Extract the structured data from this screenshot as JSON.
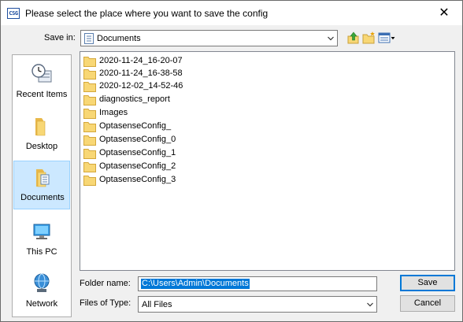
{
  "window": {
    "title": "Please select the place where you want to save the config",
    "app_icon_text": "CSG",
    "close_symbol": "✕"
  },
  "save_in": {
    "label": "Save in:",
    "value": "Documents",
    "icon": "documents-folder-icon"
  },
  "toolbar": {
    "icons": [
      "up-one-level-icon",
      "create-new-folder-icon",
      "view-menu-icon"
    ]
  },
  "places": [
    {
      "label": "Recent Items",
      "icon": "recent-items-icon",
      "selected": false
    },
    {
      "label": "Desktop",
      "icon": "desktop-folder-icon",
      "selected": false
    },
    {
      "label": "Documents",
      "icon": "documents-icon",
      "selected": true
    },
    {
      "label": "This PC",
      "icon": "computer-icon",
      "selected": false
    },
    {
      "label": "Network",
      "icon": "network-icon",
      "selected": false
    }
  ],
  "files": [
    "2020-11-24_16-20-07",
    "2020-11-24_16-38-58",
    "2020-12-02_14-52-46",
    "diagnostics_report",
    "Images",
    "OptasenseConfig_",
    "OptasenseConfig_0",
    "OptasenseConfig_1",
    "OptasenseConfig_2",
    "OptasenseConfig_3"
  ],
  "folder_name": {
    "label": "Folder name:",
    "value": "C:\\Users\\Admin\\Documents"
  },
  "files_of_type": {
    "label": "Files of Type:",
    "value": "All Files"
  },
  "buttons": {
    "save": "Save",
    "cancel": "Cancel"
  },
  "colors": {
    "folder": "#f8d775",
    "selection": "#0078d7",
    "place_selected": "#cce8ff"
  }
}
